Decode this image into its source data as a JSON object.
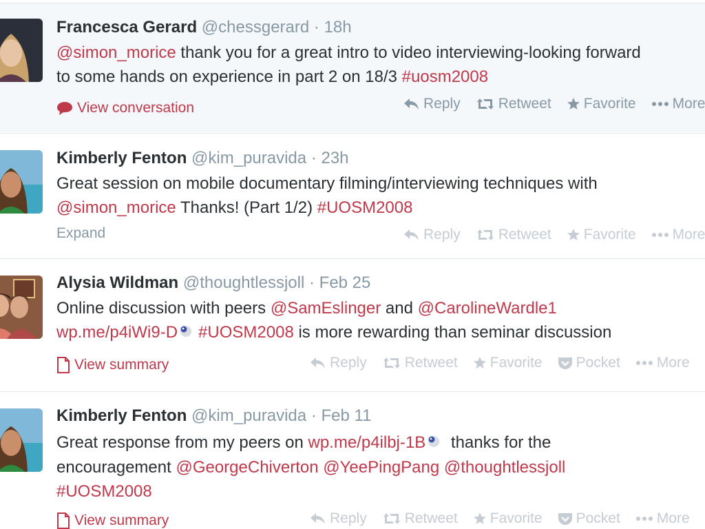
{
  "colors": {
    "link": "#c0394b",
    "muted": "#8899a6",
    "highlight_bg": "#f5f8fa"
  },
  "actions": {
    "reply": "Reply",
    "retweet": "Retweet",
    "favorite": "Favorite",
    "pocket": "Pocket",
    "more": "More"
  },
  "tweets": [
    {
      "fullname": "Francesca Gerard",
      "username": "@chessgerard",
      "separator": "·",
      "time": "18h",
      "line1_mention": "@simon_morice",
      "line1_text": " thank you for a great intro to video interviewing-looking forward",
      "line2_text": "to some hands on experience in part 2 on 18/3 ",
      "line2_hashtag": "#uosm2008",
      "detail_label": "View conversation"
    },
    {
      "fullname": "Kimberly Fenton",
      "username": "@kim_puravida",
      "separator": "·",
      "time": "23h",
      "line1_text": "Great session on mobile documentary filming/interviewing techniques with",
      "line2_mention": "@simon_morice",
      "line2_text": " Thanks! (Part 1/2) ",
      "line2_hashtag": "#UOSM2008",
      "expand_label": "Expand"
    },
    {
      "fullname": "Alysia Wildman",
      "username": "@thoughtlessjoll",
      "separator": "·",
      "time": "Feb 25",
      "line1_text": "Online discussion with peers ",
      "line1_mention1": "@SamEslinger",
      "line1_and": " and ",
      "line1_mention2": "@CarolineWardle1",
      "line2_link": "wp.me/p4iWi9-D",
      "line2_hashtag": "#UOSM2008",
      "line2_text": " is more rewarding than seminar discussion",
      "detail_label": "View summary"
    },
    {
      "fullname": "Kimberly Fenton",
      "username": "@kim_puravida",
      "separator": "·",
      "time": "Feb 11",
      "line1_text": "Great response from my peers on ",
      "line1_link": "wp.me/p4ilbj-1B",
      "line1_text2": " thanks for the",
      "line2_text": "encouragement ",
      "line2_mention1": "@GeorgeChiverton",
      "line2_mention2": "@YeePingPang",
      "line2_mention3": "@thoughtlessjoll",
      "line3_hashtag": "#UOSM2008",
      "detail_label": "View summary"
    }
  ]
}
